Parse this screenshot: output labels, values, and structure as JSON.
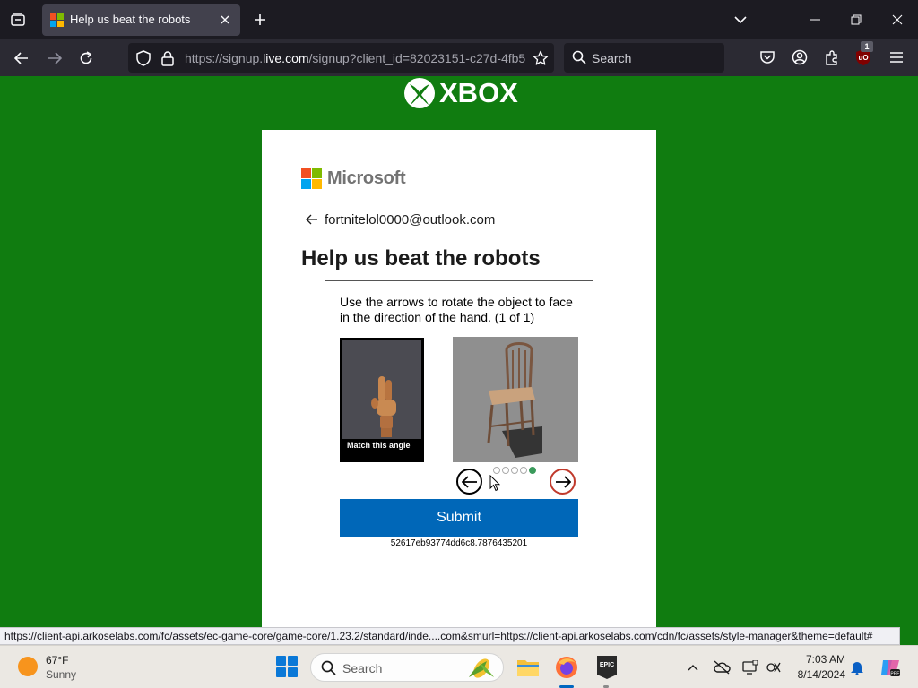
{
  "browser": {
    "tab": {
      "title": "Help us beat the robots"
    },
    "url": {
      "prefix": "https://signup.",
      "host": "live.com",
      "path": "/signup?client_id=82023151-c27d-4fb5"
    },
    "search": {
      "placeholder": "Search"
    },
    "extension_badge": "1",
    "status_link": "https://client-api.arkoselabs.com/fc/assets/ec-game-core/game-core/1.23.2/standard/inde....com&smurl=https://client-api.arkoselabs.com/cdn/fc/assets/style-manager&theme=default#"
  },
  "page": {
    "brand": "XBOX",
    "background_color": "#107c10",
    "card": {
      "logo_text": "Microsoft",
      "identity": "fortnitelol0000@outlook.com",
      "heading": "Help us beat the robots",
      "captcha": {
        "instructions": "Use the arrows to rotate the object to face in the direction of the hand. (1 of 1)",
        "reference_label": "Match this angle",
        "dots_total": 5,
        "dots_active_index": 4,
        "prev_icon": "arrow-left-icon",
        "next_icon": "arrow-right-icon",
        "submit_label": "Submit",
        "session_id": "52617eb93774dd6c8.7876435201"
      }
    }
  },
  "taskbar": {
    "weather": {
      "temp": "67°F",
      "condition": "Sunny"
    },
    "search_placeholder": "Search",
    "clock": {
      "time": "7:03 AM",
      "date": "8/14/2024"
    },
    "epic_label": "EPIC"
  }
}
